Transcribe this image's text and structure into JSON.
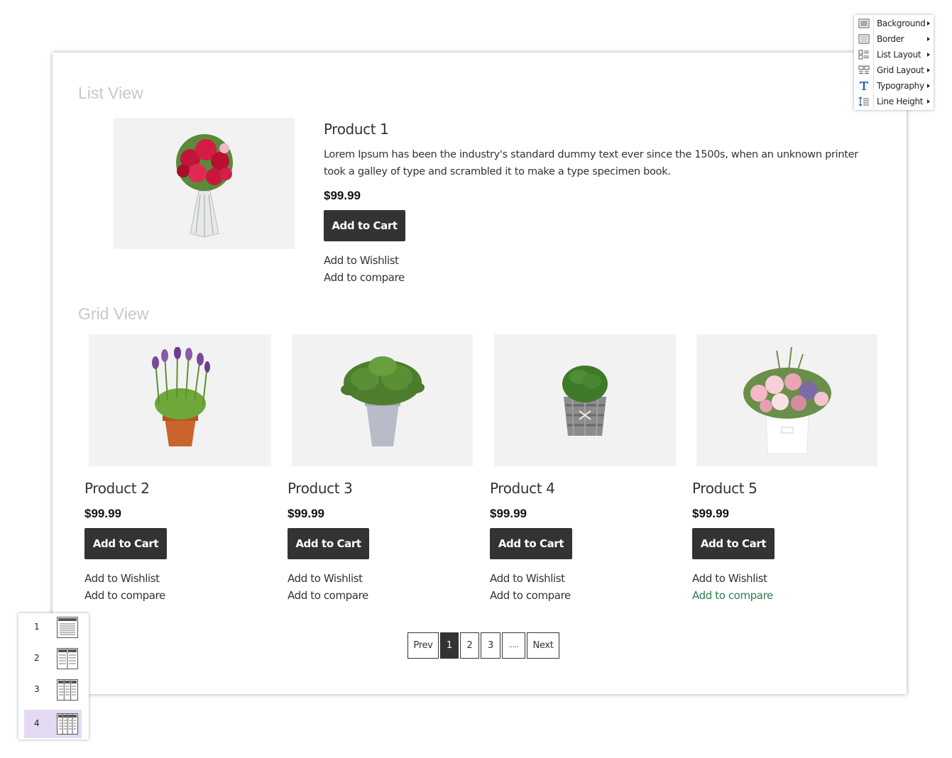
{
  "list_view": {
    "title": "List View",
    "product": {
      "name": "Product 1",
      "description": "Lorem Ipsum has been the industry's standard dummy text ever since the 1500s, when an unknown printer took a galley of type and scrambled it to make a type specimen book.",
      "price": "$99.99",
      "add_to_cart": "Add to Cart",
      "add_to_wishlist": "Add to Wishlist",
      "add_to_compare": "Add to compare",
      "image": "rose-bouquet"
    }
  },
  "grid_view": {
    "title": "Grid View",
    "products": [
      {
        "name": "Product 2",
        "price": "$99.99",
        "add_to_cart": "Add to Cart",
        "add_to_wishlist": "Add to Wishlist",
        "add_to_compare": "Add to compare",
        "image": "lavender-pot"
      },
      {
        "name": "Product 3",
        "price": "$99.99",
        "add_to_cart": "Add to Cart",
        "add_to_wishlist": "Add to Wishlist",
        "add_to_compare": "Add to compare",
        "image": "green-plant-grey-pot"
      },
      {
        "name": "Product 4",
        "price": "$99.99",
        "add_to_cart": "Add to Cart",
        "add_to_wishlist": "Add to Wishlist",
        "add_to_compare": "Add to compare",
        "image": "shrub-basket"
      },
      {
        "name": "Product 5",
        "price": "$99.99",
        "add_to_cart": "Add to Cart",
        "add_to_wishlist": "Add to Wishlist",
        "add_to_compare": "Add to compare",
        "image": "flower-box"
      }
    ]
  },
  "pagination": {
    "prev": "Prev",
    "pages": [
      "1",
      "2",
      "3"
    ],
    "ellipsis": ".....",
    "next": "Next",
    "active_page": "1"
  },
  "style_menu": {
    "items": [
      {
        "label": "Background",
        "icon": "background-icon"
      },
      {
        "label": "Border",
        "icon": "border-icon"
      },
      {
        "label": "List Layout",
        "icon": "list-layout-icon"
      },
      {
        "label": "Grid Layout",
        "icon": "grid-layout-icon"
      },
      {
        "label": "Typography",
        "icon": "typography-icon"
      },
      {
        "label": "Line Height",
        "icon": "line-height-icon"
      }
    ]
  },
  "columns_picker": {
    "options": [
      "1",
      "2",
      "3",
      "4"
    ],
    "selected": "4"
  },
  "colors": {
    "button_bg": "#333333",
    "hover_link": "#2e7d4f",
    "selected_option": "#e4d9f3",
    "section_title": "#c8c8c8"
  }
}
